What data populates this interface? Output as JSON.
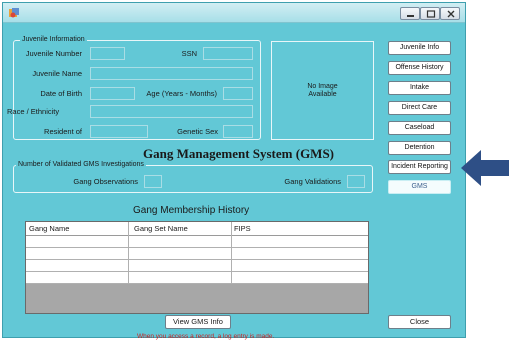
{
  "window": {
    "icon": "app-icon",
    "controls": [
      "minimize-icon",
      "maximize-icon",
      "close-icon"
    ]
  },
  "juvenile_info": {
    "legend": "Juvenile Information",
    "juvenile_number_label": "Juvenile Number",
    "ssn_label": "SSN",
    "juvenile_name_label": "Juvenile Name",
    "dob_label": "Date of Birth",
    "age_label": "Age (Years - Months)",
    "race_label": "Race / Ethnicity",
    "resident_label": "Resident of",
    "genetic_sex_label": "Genetic Sex",
    "photo_line1": "No Image",
    "photo_line2": "Available"
  },
  "sidebar": {
    "buttons": [
      {
        "label": "Juvenile Info"
      },
      {
        "label": "Offense History"
      },
      {
        "label": "Intake"
      },
      {
        "label": "Direct Care"
      },
      {
        "label": "Caseload"
      },
      {
        "label": "Detention"
      },
      {
        "label": "Incident Reporting"
      },
      {
        "label": "GMS"
      }
    ]
  },
  "gms": {
    "title": "Gang Management System (GMS)",
    "legend": "Number of Validated GMS Investigations",
    "observations_label": "Gang Observations",
    "validations_label": "Gang Validations"
  },
  "history": {
    "title": "Gang Membership History",
    "columns": [
      "Gang Name",
      "Gang Set Name",
      "FIPS"
    ],
    "rows": 4
  },
  "footer": {
    "view_button": "View GMS Info",
    "close_button": "Close",
    "note": "When you access a record, a log entry is made."
  },
  "colors": {
    "window_bg": "#62c8d6",
    "arrow": "#2e4f86",
    "note": "#cc1d1d"
  }
}
